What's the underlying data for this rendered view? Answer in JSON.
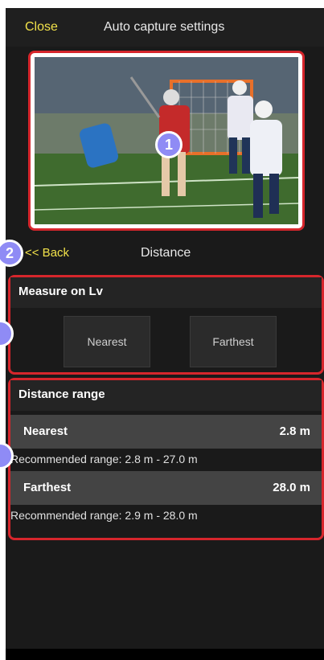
{
  "header": {
    "close_label": "Close",
    "title": "Auto capture settings"
  },
  "preview": {
    "callout": "1"
  },
  "nav": {
    "callout": "2",
    "back_label": "<< Back",
    "title": "Distance"
  },
  "measure": {
    "title": "Measure on Lv",
    "nearest_label": "Nearest",
    "farthest_label": "Farthest"
  },
  "range": {
    "title": "Distance range",
    "nearest": {
      "label": "Nearest",
      "value": "2.8 m",
      "hint": "Recommended range: 2.8 m - 27.0 m"
    },
    "farthest": {
      "label": "Farthest",
      "value": "28.0 m",
      "hint": "Recommended range: 2.9 m - 28.0 m"
    }
  },
  "colors": {
    "accent": "#f2e24a",
    "callout": "#8f8bf5",
    "highlight": "#d6262c"
  }
}
